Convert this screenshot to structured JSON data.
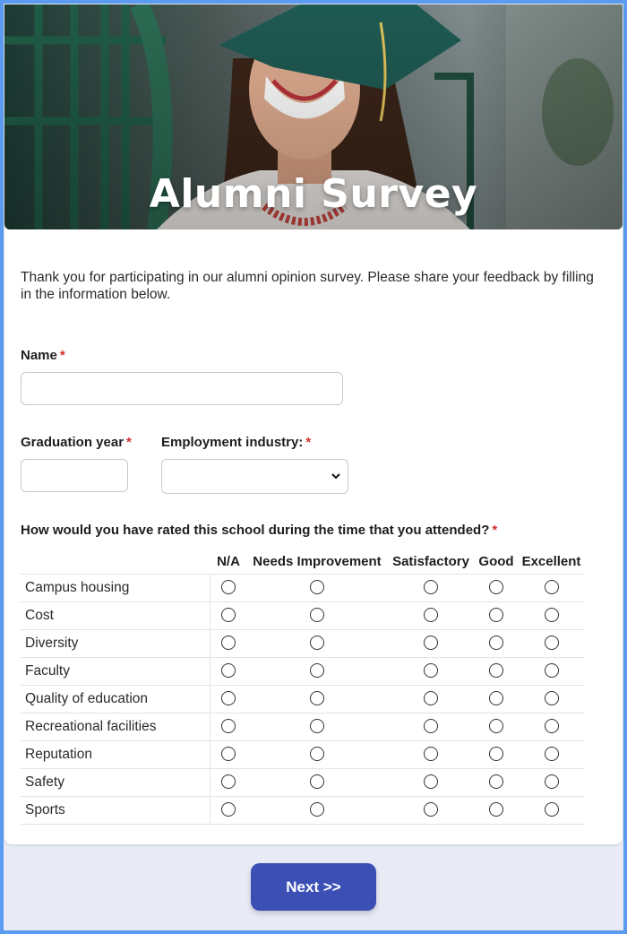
{
  "hero": {
    "title": "Alumni Survey"
  },
  "intro": "Thank you for participating in our alumni opinion survey. Please share your feedback by filling in the information below.",
  "fields": {
    "name": {
      "label": "Name",
      "required": "*",
      "value": ""
    },
    "graduation_year": {
      "label": "Graduation year",
      "required": "*",
      "value": ""
    },
    "employment_industry": {
      "label": "Employment industry:",
      "required": "*",
      "selected": ""
    }
  },
  "matrix": {
    "question": "How would you have rated this school during the time that you attended?",
    "required": "*",
    "columns": [
      "N/A",
      "Needs Improvement",
      "Satisfactory",
      "Good",
      "Excellent"
    ],
    "rows": [
      "Campus housing",
      "Cost",
      "Diversity",
      "Faculty",
      "Quality of education",
      "Recreational facilities",
      "Reputation",
      "Safety",
      "Sports"
    ]
  },
  "next_button": {
    "label": "Next >>"
  },
  "colors": {
    "accent": "#3c4fb5",
    "required": "#d0312d",
    "frame": "#5b9cf0",
    "page": "#e8ebf5"
  }
}
